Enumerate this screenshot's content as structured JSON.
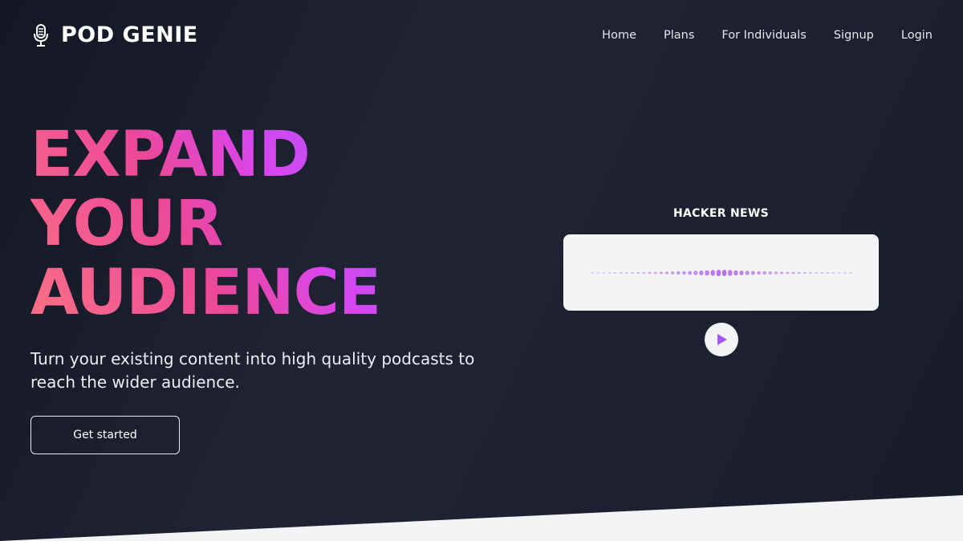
{
  "brand": {
    "name": "POD GENIE",
    "icon": "microphone-icon"
  },
  "nav": {
    "items": [
      "Home",
      "Plans",
      "For Individuals",
      "Signup",
      "Login"
    ]
  },
  "hero": {
    "title_lines": [
      "EXPAND",
      "YOUR",
      "AUDIENCE"
    ],
    "subtitle": "Turn your existing content into high quality podcasts to reach the wider audience.",
    "cta_label": "Get started"
  },
  "player": {
    "title": "HACKER NEWS",
    "play_icon": "play-icon",
    "waveform_icon": "waveform-icon"
  },
  "colors": {
    "background": "#1f2333",
    "accent_purple": "#a855f7",
    "accent_pink": "#ec4899",
    "accent_coral": "#fb7185",
    "card_background": "#f3f4f6"
  }
}
